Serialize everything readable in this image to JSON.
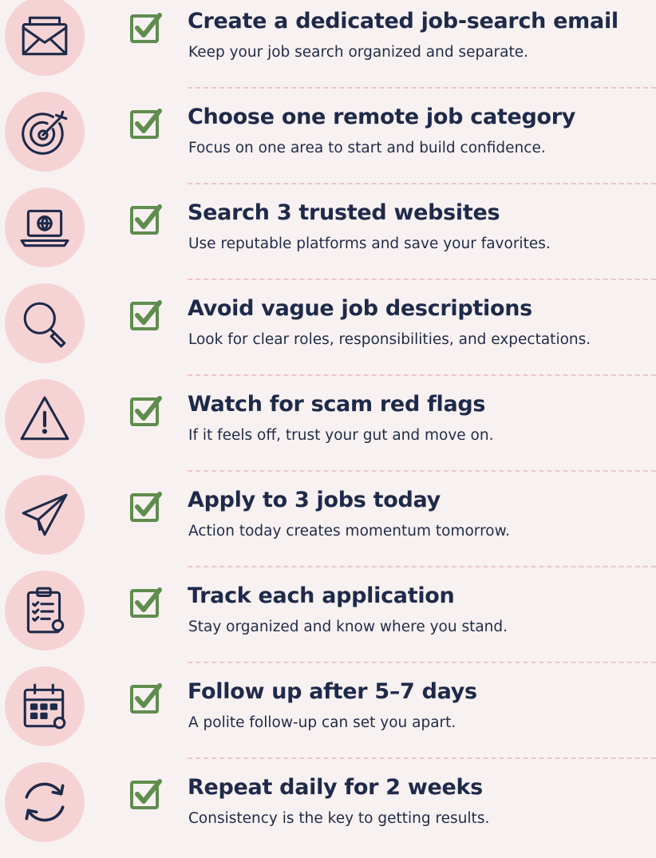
{
  "items": [
    {
      "title": "Create a dedicated job-search email",
      "subtitle": "Keep your job search organized and separate.",
      "icon": "envelope-icon"
    },
    {
      "title": "Choose one remote job category",
      "subtitle": "Focus on one area to start and build confidence.",
      "icon": "target-icon"
    },
    {
      "title": "Search 3 trusted websites",
      "subtitle": "Use reputable platforms and save your favorites.",
      "icon": "laptop-globe-icon"
    },
    {
      "title": "Avoid vague job descriptions",
      "subtitle": "Look for clear roles, responsibilities, and expectations.",
      "icon": "magnifier-icon"
    },
    {
      "title": "Watch for scam red flags",
      "subtitle": "If it feels off, trust your gut and move on.",
      "icon": "warning-icon"
    },
    {
      "title": "Apply to 3 jobs today",
      "subtitle": "Action today creates momentum tomorrow.",
      "icon": "paper-plane-icon"
    },
    {
      "title": "Track each application",
      "subtitle": "Stay organized and know where you stand.",
      "icon": "clipboard-icon"
    },
    {
      "title": "Follow up after 5–7 days",
      "subtitle": "A polite follow-up can set you apart.",
      "icon": "calendar-icon"
    },
    {
      "title": "Repeat daily for 2 weeks",
      "subtitle": "Consistency is the key to getting results.",
      "icon": "repeat-icon"
    }
  ],
  "colors": {
    "background": "#f8f1f1",
    "icon_circle": "#f5d3d4",
    "check_green": "#5f8d4e",
    "text_navy": "#1e2a4a",
    "divider": "#ecc7c9"
  }
}
